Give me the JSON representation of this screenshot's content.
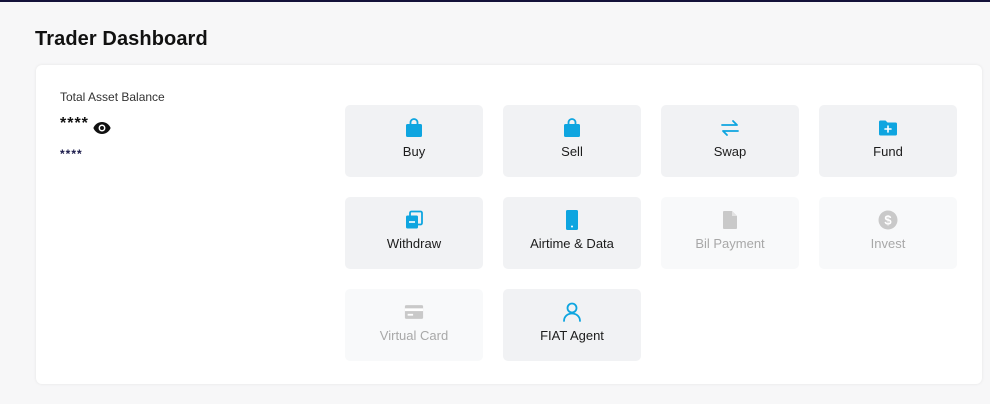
{
  "page": {
    "title": "Trader Dashboard"
  },
  "balance": {
    "label": "Total Asset Balance",
    "main_value": "****",
    "sub_value": "****"
  },
  "colors": {
    "accent": "#0ea5e0",
    "disabled_icon": "#c9c9c9",
    "disabled_text": "#a8a8a8"
  },
  "actions": [
    {
      "label": "Buy",
      "icon": "shopping-bag-icon",
      "enabled": true
    },
    {
      "label": "Sell",
      "icon": "shopping-bag-icon",
      "enabled": true
    },
    {
      "label": "Swap",
      "icon": "swap-arrows-icon",
      "enabled": true
    },
    {
      "label": "Fund",
      "icon": "folder-plus-icon",
      "enabled": true
    },
    {
      "label": "Withdraw",
      "icon": "copy-icon",
      "enabled": true
    },
    {
      "label": "Airtime & Data",
      "icon": "smartphone-icon",
      "enabled": true
    },
    {
      "label": "Bil Payment",
      "icon": "document-icon",
      "enabled": false
    },
    {
      "label": "Invest",
      "icon": "dollar-circle-icon",
      "enabled": false
    },
    {
      "label": "Virtual Card",
      "icon": "credit-card-icon",
      "enabled": false
    },
    {
      "label": "FIAT Agent",
      "icon": "user-icon",
      "enabled": true
    }
  ]
}
